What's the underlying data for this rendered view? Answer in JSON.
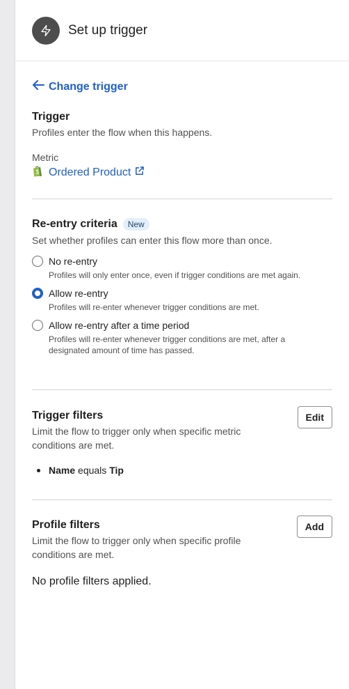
{
  "header": {
    "title": "Set up trigger",
    "icon": "lightning-bolt-icon"
  },
  "back_link": {
    "label": "Change trigger",
    "icon": "arrow-left-icon"
  },
  "trigger": {
    "title": "Trigger",
    "description": "Profiles enter the flow when this happens.",
    "metric_label": "Metric",
    "metric_value": "Ordered Product",
    "metric_source_icon": "shopify-bag-icon",
    "metric_link_icon": "external-link-icon"
  },
  "reentry": {
    "title": "Re-entry criteria",
    "badge": "New",
    "description": "Set whether profiles can enter this flow more than once.",
    "selected_option": "Allow re-entry",
    "options": [
      {
        "label": "No re-entry",
        "help": "Profiles will only enter once, even if trigger conditions are met again."
      },
      {
        "label": "Allow re-entry",
        "help": "Profiles will re-enter whenever trigger conditions are met."
      },
      {
        "label": "Allow re-entry after a time period",
        "help": "Profiles will re-enter whenever trigger conditions are met, after a designated amount of time has passed."
      }
    ]
  },
  "trigger_filters": {
    "title": "Trigger filters",
    "description": "Limit the flow to trigger only when specific metric conditions are met.",
    "button_label": "Edit",
    "filters": [
      {
        "field": "Name",
        "operator": "equals",
        "value": "Tip"
      }
    ]
  },
  "profile_filters": {
    "title": "Profile filters",
    "description": "Limit the flow to trigger only when specific profile conditions are met.",
    "button_label": "Add",
    "empty_text": "No profile filters applied."
  },
  "colors": {
    "accent": "#1f5fc9",
    "header_icon_bg": "#4d4d4d",
    "badge_bg": "#e3effb",
    "shopify_green": "#95bf47"
  }
}
